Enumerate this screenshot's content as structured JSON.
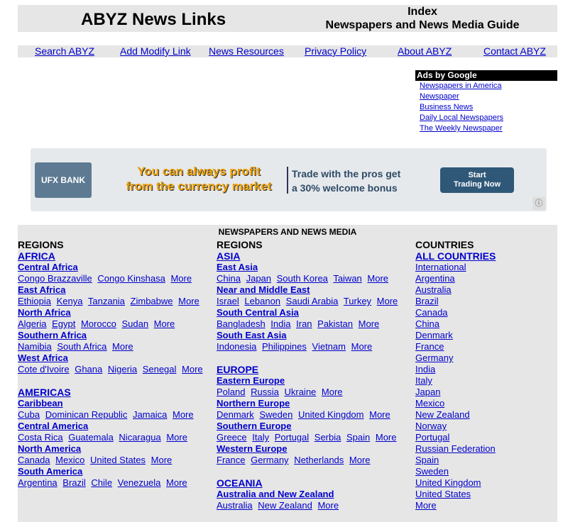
{
  "header": {
    "title": "ABYZ News Links",
    "right_line1": "Index",
    "right_line2": "Newspapers and News Media Guide"
  },
  "nav": [
    "Search ABYZ",
    "Add Modify Link",
    "News Resources",
    "Privacy Policy",
    "About ABYZ",
    "Contact ABYZ"
  ],
  "ads": {
    "heading": "Ads by Google",
    "links": [
      "Newspapers in America",
      "Newspaper",
      "Business News",
      "Daily Local Newspapers",
      "The Weekly Newspaper"
    ]
  },
  "banner": {
    "logo": "UFX BANK",
    "line1": "You can always profit",
    "line2": "from the currency market",
    "promo1": "Trade with the pros get",
    "promo2": "a 30% welcome bonus",
    "button1": "Start",
    "button2": "Trading Now",
    "info_icon": "info-icon"
  },
  "main": {
    "title": "NEWSPAPERS AND NEWS MEDIA",
    "col1": {
      "heading": "REGIONS",
      "africa": "AFRICA",
      "central_africa": "Central Africa",
      "central_africa_links": [
        "Congo Brazzaville",
        "Congo Kinshasa",
        "More"
      ],
      "east_africa": "East Africa",
      "east_africa_links": [
        "Ethiopia",
        "Kenya",
        "Tanzania",
        "Zimbabwe",
        "More"
      ],
      "north_africa": "North Africa",
      "north_africa_links": [
        "Algeria",
        "Egypt",
        "Morocco",
        "Sudan",
        "More"
      ],
      "southern_africa": "Southern Africa",
      "southern_africa_links": [
        "Namibia",
        "South Africa",
        "More"
      ],
      "west_africa": "West Africa",
      "west_africa_links": [
        "Cote d'Ivoire",
        "Ghana",
        "Nigeria",
        "Senegal",
        "More"
      ],
      "americas": "AMERICAS",
      "caribbean": "Caribbean",
      "caribbean_links": [
        "Cuba",
        "Dominican Republic",
        "Jamaica",
        "More"
      ],
      "central_america": "Central America",
      "central_america_links": [
        "Costa Rica",
        "Guatemala",
        "Nicaragua",
        "More"
      ],
      "north_america": "North America",
      "north_america_links": [
        "Canada",
        "Mexico",
        "United States",
        "More"
      ],
      "south_america": "South America",
      "south_america_links": [
        "Argentina",
        "Brazil",
        "Chile",
        "Venezuela",
        "More"
      ]
    },
    "col2": {
      "heading": "REGIONS",
      "asia": "ASIA",
      "east_asia": "East Asia",
      "east_asia_links": [
        "China",
        "Japan",
        "South Korea",
        "Taiwan",
        "More"
      ],
      "near_middle_east": "Near and Middle East",
      "near_middle_east_links": [
        "Israel",
        "Lebanon",
        "Saudi Arabia",
        "Turkey",
        "More"
      ],
      "south_central_asia": "South Central Asia",
      "south_central_asia_links": [
        "Bangladesh",
        "India",
        "Iran",
        "Pakistan",
        "More"
      ],
      "south_east_asia": "South East Asia",
      "south_east_asia_links": [
        "Indonesia",
        "Philippines",
        "Vietnam",
        "More"
      ],
      "europe": "EUROPE",
      "eastern_europe": "Eastern Europe",
      "eastern_europe_links": [
        "Poland",
        "Russia",
        "Ukraine",
        "More"
      ],
      "northern_europe": "Northern Europe",
      "northern_europe_links": [
        "Denmark",
        "Sweden",
        "United Kingdom",
        "More"
      ],
      "southern_europe": "Southern Europe",
      "southern_europe_links": [
        "Greece",
        "Italy",
        "Portugal",
        "Serbia",
        "Spain",
        "More"
      ],
      "western_europe": "Western Europe",
      "western_europe_links": [
        "France",
        "Germany",
        "Netherlands",
        "More"
      ],
      "oceania": "OCEANIA",
      "aus_nz": "Australia and New Zealand",
      "aus_nz_links": [
        "Australia",
        "New Zealand",
        "More"
      ]
    },
    "col3": {
      "heading": "COUNTRIES",
      "all": "ALL COUNTRIES",
      "countries": [
        "International",
        "Argentina",
        "Australia",
        "Brazil",
        "Canada",
        "China",
        "Denmark",
        "France",
        "Germany",
        "India",
        "Italy",
        "Japan",
        "Mexico",
        "New Zealand",
        "Norway",
        "Portugal",
        "Russian Federation",
        "Spain",
        "Sweden",
        "United Kingdom",
        "United States",
        "More"
      ]
    }
  }
}
